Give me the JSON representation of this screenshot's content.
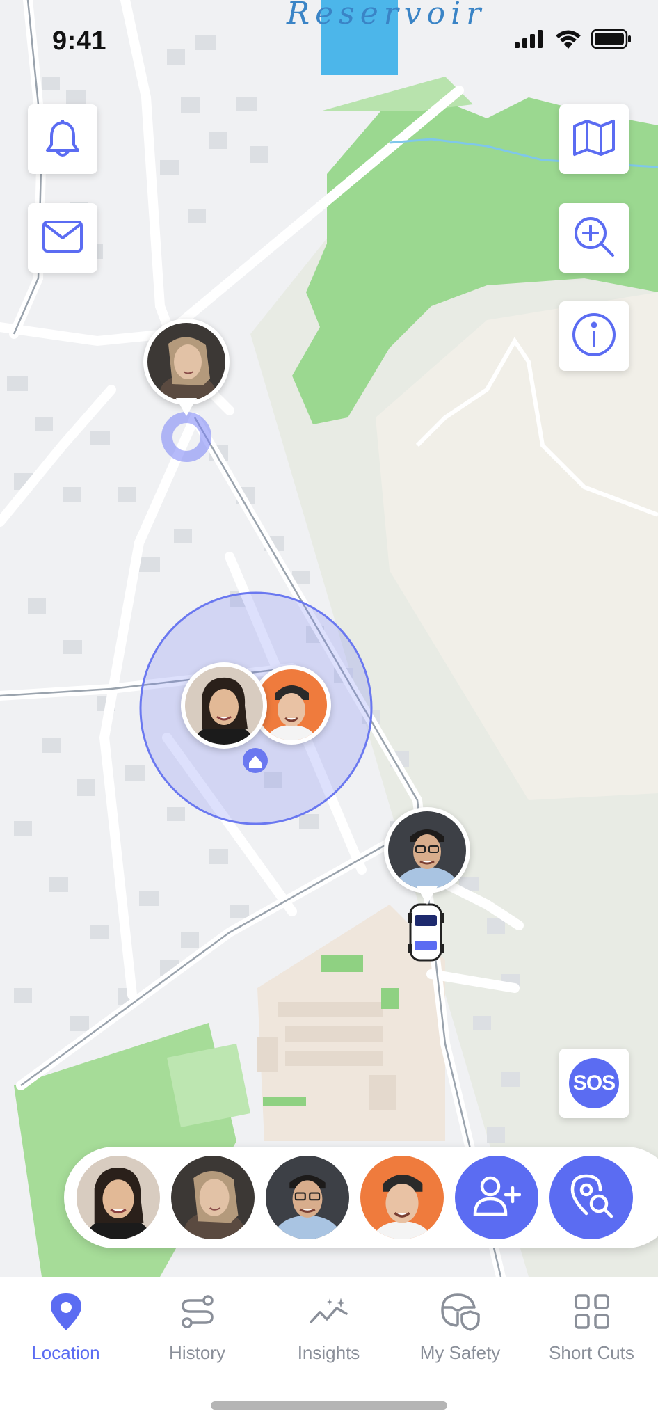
{
  "status_bar": {
    "time": "9:41"
  },
  "map": {
    "place_label": "Reservoir",
    "accent_color": "#5b6cf2",
    "controls_left": [
      {
        "name": "notifications",
        "icon": "bell-icon"
      },
      {
        "name": "messages",
        "icon": "mail-icon"
      }
    ],
    "controls_right": [
      {
        "name": "map-type",
        "icon": "map-icon"
      },
      {
        "name": "zoom",
        "icon": "zoom-in-icon"
      },
      {
        "name": "info",
        "icon": "info-icon"
      }
    ],
    "sos_label": "SOS"
  },
  "members_tray": {
    "members": [
      {
        "name": "woman-dark-hair",
        "color": "#c8b8a8"
      },
      {
        "name": "woman-long-hair",
        "color": "#4a4440"
      },
      {
        "name": "man-glasses",
        "color": "#3f4248"
      },
      {
        "name": "man-beanie",
        "color": "#f07b3f"
      }
    ],
    "actions": [
      {
        "name": "add-member",
        "icon": "add-user-icon"
      },
      {
        "name": "search-location",
        "icon": "location-search-icon"
      }
    ]
  },
  "tab_bar": {
    "tabs": [
      {
        "label": "Location",
        "icon": "location-pin-icon",
        "active": true
      },
      {
        "label": "History",
        "icon": "route-icon",
        "active": false
      },
      {
        "label": "Insights",
        "icon": "insights-icon",
        "active": false
      },
      {
        "label": "My Safety",
        "icon": "steering-shield-icon",
        "active": false
      },
      {
        "label": "Short Cuts",
        "icon": "grid-icon",
        "active": false
      }
    ]
  }
}
